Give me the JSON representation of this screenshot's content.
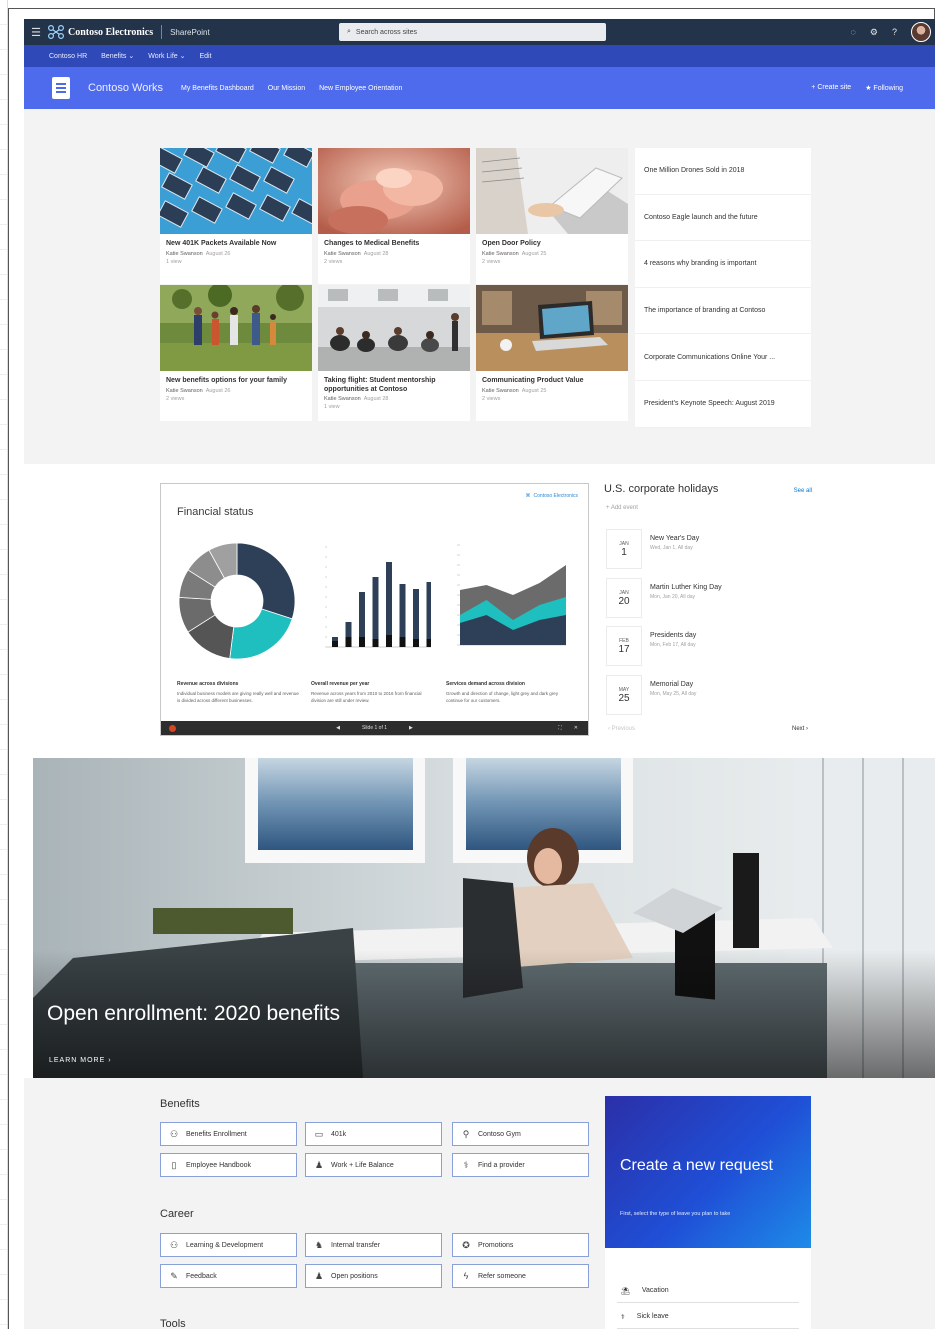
{
  "suite": {
    "brand": "Contoso Electronics",
    "app": "SharePoint",
    "search_placeholder": "Search across sites",
    "icons": [
      "waffle-icon",
      "search-icon",
      "notifications-icon",
      "gear-icon",
      "help-icon"
    ],
    "help": "?"
  },
  "hub": {
    "items": [
      "Contoso HR",
      "Benefits ⌄",
      "Work Life ⌄",
      "Edit"
    ]
  },
  "site": {
    "title": "Contoso Works",
    "nav": [
      "My Benefits Dashboard",
      "Our Mission",
      "New Employee Orientation"
    ],
    "actions": [
      "Create site",
      "Following"
    ]
  },
  "news": {
    "cards": [
      {
        "title": "New 401K Packets Available Now",
        "author": "Katie Swanson",
        "date": "August 26",
        "views": "1 view"
      },
      {
        "title": "Changes to Medical Benefits",
        "author": "Katie Swanson",
        "date": "August 28",
        "views": "2 views"
      },
      {
        "title": "Open Door Policy",
        "author": "Katie Swanson",
        "date": "August 25",
        "views": "2 views"
      },
      {
        "title": "New benefits options for your family",
        "author": "Katie Swanson",
        "date": "August 26",
        "views": "2 views"
      },
      {
        "title": "Taking flight: Student mentorship opportunities at Contoso",
        "author": "Katie Swanson",
        "date": "August 28",
        "views": "1 view"
      },
      {
        "title": "Communicating Product Value",
        "author": "Katie Swanson",
        "date": "August 25",
        "views": "2 views"
      }
    ],
    "headlines": [
      "One Million Drones Sold in 2018",
      "Contoso Eagle launch and the future",
      "4 reasons why branding is important",
      "The importance of branding at Contoso",
      "Corporate Communications Online Your ...",
      "President’s Keynote Speech: August 2019"
    ]
  },
  "financial": {
    "title": "Financial status",
    "brand": "Contoso Electronics",
    "sections": [
      {
        "label": "Revenue across divisions",
        "desc": "Individual business models are giving really well and revenue is divided across different businesses."
      },
      {
        "label": "Overall revenue per year",
        "desc": "Revenue across years from 2010 to 2016 from financial division are still under review."
      },
      {
        "label": "Services demand across division",
        "desc": "Growth and direction of change, light grey and dark grey continue for our customers."
      }
    ],
    "slide": "Slide 1 of 1",
    "colors": {
      "dark": "#2e4057",
      "teal": "#1fbfbf",
      "grey": "#6b6b6b",
      "black": "#111111"
    }
  },
  "chart_data": [
    {
      "type": "pie",
      "values": [
        30,
        22,
        14,
        10,
        8,
        8,
        8
      ],
      "colors": [
        "#2e4057",
        "#1fbfbf",
        "#555555",
        "#6b6b6b",
        "#7a7a7a",
        "#8d8d8d",
        "#a0a0a0"
      ]
    },
    {
      "type": "bar",
      "series": [
        {
          "values": [
            10,
            25,
            55,
            70,
            85,
            63,
            58,
            65
          ]
        },
        {
          "values": [
            6,
            10,
            10,
            8,
            12,
            10,
            8,
            8
          ]
        }
      ]
    },
    {
      "type": "area",
      "series": [
        {
          "values": [
            55,
            60,
            50,
            62,
            80
          ]
        },
        {
          "values": [
            30,
            45,
            25,
            40,
            48
          ]
        },
        {
          "values": [
            22,
            30,
            15,
            25,
            30
          ]
        }
      ]
    }
  ],
  "holidays": {
    "title": "U.S. corporate holidays",
    "see_all": "See all",
    "add": "+ Add event",
    "events": [
      {
        "month": "JAN",
        "day": "1",
        "name": "New Year's Day",
        "time": "Wed, Jan 1, All day"
      },
      {
        "month": "JAN",
        "day": "20",
        "name": "Martin Luther King Day",
        "time": "Mon, Jan 20, All day"
      },
      {
        "month": "FEB",
        "day": "17",
        "name": "Presidents day",
        "time": "Mon, Feb 17, All day"
      },
      {
        "month": "MAY",
        "day": "25",
        "name": "Memorial Day",
        "time": "Mon, May 25, All day"
      }
    ],
    "prev": "‹  Previous",
    "next": "Next  ›"
  },
  "hero": {
    "title": "Open enrollment: 2020 benefits",
    "more": "LEARN MORE  ›"
  },
  "benefits": {
    "heading": "Benefits",
    "links": [
      {
        "label": "Benefits Enrollment",
        "icon": "people-icon"
      },
      {
        "label": "401k",
        "icon": "money-icon"
      },
      {
        "label": "Contoso Gym",
        "icon": "fitness-icon"
      },
      {
        "label": "Employee Handbook",
        "icon": "book-icon"
      },
      {
        "label": "Work + Life Balance",
        "icon": "family-icon"
      },
      {
        "label": "Find a provider",
        "icon": "stethoscope-icon"
      }
    ]
  },
  "career": {
    "heading": "Career",
    "links": [
      {
        "label": "Learning & Development",
        "icon": "learning-icon"
      },
      {
        "label": "Internal transfer",
        "icon": "transfer-icon"
      },
      {
        "label": "Promotions",
        "icon": "award-icon"
      },
      {
        "label": "Feedback",
        "icon": "feedback-icon"
      },
      {
        "label": "Open positions",
        "icon": "positions-icon"
      },
      {
        "label": "Refer someone",
        "icon": "refer-icon"
      }
    ]
  },
  "tools": {
    "heading": "Tools"
  },
  "cta": {
    "title": "Create a new request",
    "sub": "First, select the type of leave you plan to take"
  },
  "requests": [
    {
      "label": "Vacation",
      "icon": "vacation-icon"
    },
    {
      "label": "Sick leave",
      "icon": "sick-icon"
    }
  ]
}
